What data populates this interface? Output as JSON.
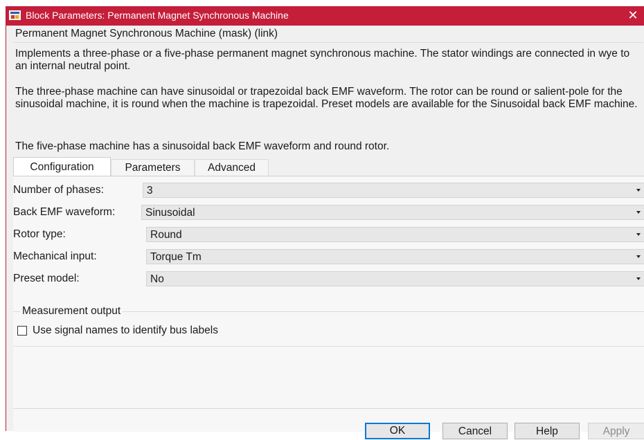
{
  "window": {
    "title": "Block Parameters: Permanent Magnet Synchronous Machine",
    "close_glyph": "✕"
  },
  "block": {
    "title": "Permanent Magnet Synchronous Machine (mask) (link)",
    "description": [
      "Implements a three-phase or a five-phase permanent magnet synchronous machine. The stator windings are connected in wye to an internal neutral point.",
      "The three-phase machine can have sinusoidal or trapezoidal back EMF waveform. The rotor can be round or salient-pole for the sinusoidal machine, it is round when the machine is trapezoidal. Preset models are available for the Sinusoidal back EMF machine.",
      "The five-phase machine has a sinusoidal back EMF waveform and round rotor."
    ]
  },
  "tabs": [
    {
      "label": "Configuration",
      "active": true
    },
    {
      "label": "Parameters",
      "active": false
    },
    {
      "label": "Advanced",
      "active": false
    }
  ],
  "params": [
    {
      "label": "Number of phases:",
      "value": "3"
    },
    {
      "label": "Back EMF waveform:",
      "value": "Sinusoidal"
    },
    {
      "label": "Rotor type:",
      "value": "Round"
    },
    {
      "label": "Mechanical input:",
      "value": "Torque Tm"
    },
    {
      "label": "Preset model:",
      "value": "No"
    }
  ],
  "measurement": {
    "group_label": "Measurement output",
    "checkbox_label": "Use signal names to identify bus labels",
    "checked": false
  },
  "buttons": {
    "ok": "OK",
    "cancel": "Cancel",
    "help": "Help",
    "apply": "Apply"
  },
  "colors": {
    "titlebar": "#c41e3a",
    "default_button_border": "#0078d7"
  },
  "icons": {
    "app": "simulink-block-icon",
    "close": "close-icon",
    "dropdown": "chevron-down-icon"
  }
}
